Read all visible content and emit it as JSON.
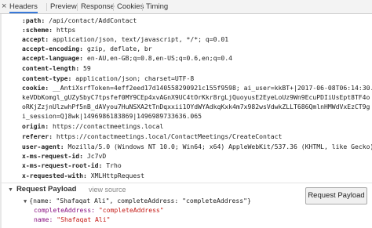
{
  "tabs": [
    {
      "label": "Headers",
      "active": true
    },
    {
      "label": "Preview",
      "active": false
    },
    {
      "label": "Response",
      "active": false
    },
    {
      "label": "Cookies",
      "active": false
    },
    {
      "label": "Timing",
      "active": false
    }
  ],
  "headers": [
    {
      "key": ":path:",
      "value": "/api/contact/AddContact"
    },
    {
      "key": ":scheme:",
      "value": "https"
    },
    {
      "key": "accept:",
      "value": "application/json, text/javascript, */*; q=0.01"
    },
    {
      "key": "accept-encoding:",
      "value": "gzip, deflate, br"
    },
    {
      "key": "accept-language:",
      "value": "en-AU,en-GB;q=0.8,en-US;q=0.6,en;q=0.4"
    },
    {
      "key": "content-length:",
      "value": "59"
    },
    {
      "key": "content-type:",
      "value": "application/json; charset=UTF-8"
    },
    {
      "key": "cookie:",
      "value": "__AntiXsrfToken=4eff2eed17d140558290921c155f9598; ai_user=kkBT+|2017-06-08T06:14:30.1"
    },
    {
      "key": "",
      "value": "keVDbKomgl_gUZySbyC7tpsfef0MY9CEp4xvAGnX9UC4tOrKkr8rgLjQuoyusE2EyeLoUz9Wn9EcuPDIiUsEpt8TF4o"
    },
    {
      "key": "",
      "value": "oRKjZzjnUlzwhPf5nB_dAVyou7HuNSXA2tTnDqxxii1OYdWYAdkqKxk4m7x982wsVdwkZLLT686QmlnHMWdVxEzCT9g"
    },
    {
      "key": "",
      "value": "i_session=Q]8wk|1496986183869|1496989733636.065"
    },
    {
      "key": "origin:",
      "value": "https://contactmeetings.local"
    },
    {
      "key": "referer:",
      "value": "https://contactmeetings.local/ContactMeetings/CreateContact"
    },
    {
      "key": "user-agent:",
      "value": "Mozilla/5.0 (Windows NT 10.0; Win64; x64) AppleWebKit/537.36 (KHTML, like Gecko)"
    },
    {
      "key": "x-ms-request-id:",
      "value": "Jc7vD"
    },
    {
      "key": "x-ms-request-root-id:",
      "value": "Trho"
    },
    {
      "key": "x-requested-with:",
      "value": "XMLHttpRequest"
    }
  ],
  "payload": {
    "title": "Request Payload",
    "view_source": "view source",
    "summary": "{name: \"Shafaqat Ali\", completeAddress: \"completeAddress\"}",
    "props": [
      {
        "key": "completeAddress:",
        "value": "\"completeAddress\""
      },
      {
        "key": "name:",
        "value": "\"Shafaqat Ali\""
      }
    ]
  },
  "button_label": "Request Payload"
}
